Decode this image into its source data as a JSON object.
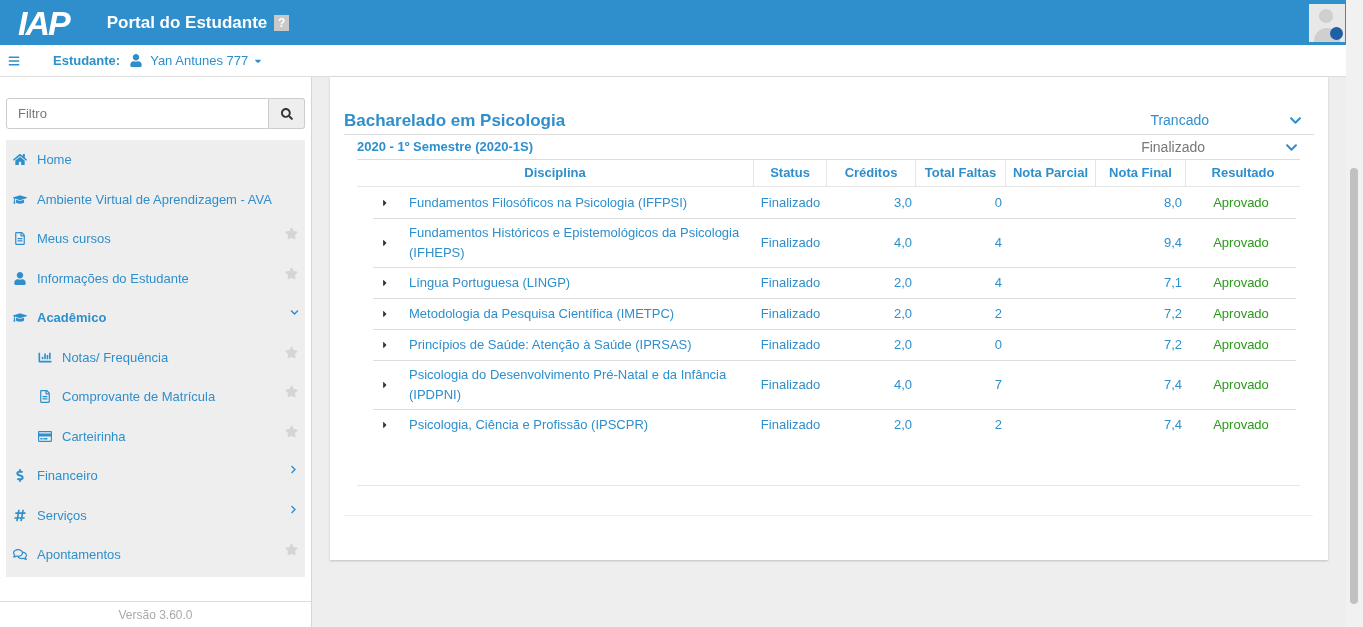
{
  "header": {
    "logo": "IAP",
    "title": "Portal do Estudante",
    "help": "?"
  },
  "subheader": {
    "label": "Estudante:",
    "student": "Yan Antunes 777"
  },
  "filter": {
    "placeholder": "Filtro"
  },
  "menu": [
    {
      "label": "Home",
      "kind": "link"
    },
    {
      "label": "Ambiente Virtual de Aprendizagem - AVA",
      "kind": "link"
    },
    {
      "label": "Meus cursos",
      "kind": "favorite"
    },
    {
      "label": "Informações do Estudante",
      "kind": "favorite"
    },
    {
      "label": "Acadêmico",
      "kind": "group",
      "expanded": true,
      "children": [
        {
          "label": "Notas/ Frequência",
          "kind": "favorite"
        },
        {
          "label": "Comprovante de Matrícula",
          "kind": "favorite"
        },
        {
          "label": "Carteirinha",
          "kind": "favorite"
        }
      ]
    },
    {
      "label": "Financeiro",
      "kind": "group",
      "expanded": false
    },
    {
      "label": "Serviços",
      "kind": "group",
      "expanded": false
    },
    {
      "label": "Apontamentos",
      "kind": "favorite"
    }
  ],
  "version": "Versão 3.60.0",
  "course": {
    "title": "Bacharelado em Psicologia",
    "status": "Trancado",
    "expanded": true
  },
  "semester": {
    "title": "2020 - 1º Semestre (2020-1S)",
    "status": "Finalizado",
    "expanded": true
  },
  "table": {
    "columns": [
      "Disciplina",
      "Status",
      "Créditos",
      "Total Faltas",
      "Nota Parcial",
      "Nota Final",
      "Resultado"
    ],
    "rows": [
      {
        "subject": "Fundamentos Filosóficos na Psicologia (IFFPSI)",
        "status": "Finalizado",
        "credits": "3,0",
        "absences": "0",
        "final": "8,0",
        "result": "Aprovado"
      },
      {
        "subject": "Fundamentos Históricos e Epistemológicos da Psicologia (IFHEPS)",
        "status": "Finalizado",
        "credits": "4,0",
        "absences": "4",
        "final": "9,4",
        "result": "Aprovado"
      },
      {
        "subject": "Língua Portuguesa (LINGP)",
        "status": "Finalizado",
        "credits": "2,0",
        "absences": "4",
        "final": "7,1",
        "result": "Aprovado"
      },
      {
        "subject": "Metodologia da Pesquisa Científica (IMETPC)",
        "status": "Finalizado",
        "credits": "2,0",
        "absences": "2",
        "final": "7,2",
        "result": "Aprovado"
      },
      {
        "subject": "Princípios de Saúde: Atenção à Saúde (IPRSAS)",
        "status": "Finalizado",
        "credits": "2,0",
        "absences": "0",
        "final": "7,2",
        "result": "Aprovado"
      },
      {
        "subject": "Psicologia do Desenvolvimento Pré-Natal e da Infância (IPDPNI)",
        "status": "Finalizado",
        "credits": "4,0",
        "absences": "7",
        "final": "7,4",
        "result": "Aprovado"
      },
      {
        "subject": "Psicologia, Ciência e Profissão (IPSCPR)",
        "status": "Finalizado",
        "credits": "2,0",
        "absences": "2",
        "final": "7,4",
        "result": "Aprovado"
      }
    ]
  }
}
